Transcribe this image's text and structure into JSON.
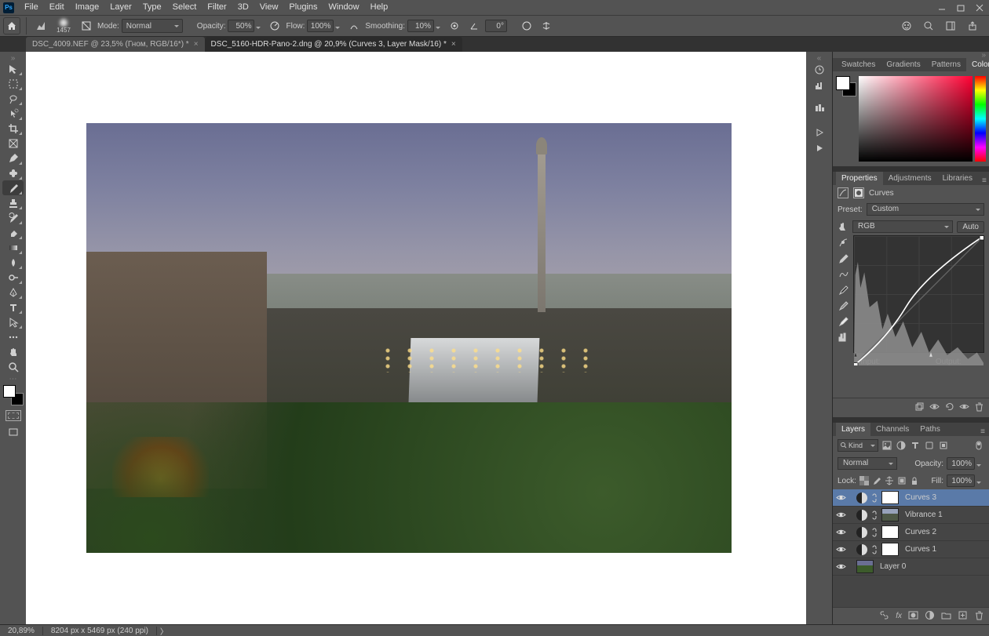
{
  "menu": [
    "File",
    "Edit",
    "Image",
    "Layer",
    "Type",
    "Select",
    "Filter",
    "3D",
    "View",
    "Plugins",
    "Window",
    "Help"
  ],
  "options": {
    "brush_size": "1457",
    "mode_label": "Mode:",
    "mode_value": "Normal",
    "opacity_label": "Opacity:",
    "opacity_value": "50%",
    "flow_label": "Flow:",
    "flow_value": "100%",
    "smoothing_label": "Smoothing:",
    "smoothing_value": "10%",
    "angle_value": "0°"
  },
  "tabs": [
    {
      "title": "DSC_4009.NEF @ 23,5% (Гном, RGB/16*) *",
      "active": false
    },
    {
      "title": "DSC_5160-HDR-Pano-2.dng @ 20,9% (Curves 3, Layer Mask/16) *",
      "active": true
    }
  ],
  "right_panels": {
    "color_tabs": [
      "Swatches",
      "Gradients",
      "Patterns",
      "Color"
    ],
    "color_active": "Color",
    "props_tabs": [
      "Properties",
      "Adjustments",
      "Libraries"
    ],
    "props_active": "Properties",
    "props_title": "Curves",
    "preset_label": "Preset:",
    "preset_value": "Custom",
    "channel_value": "RGB",
    "auto_label": "Auto",
    "input_label": "Input:",
    "output_label": "Output:",
    "layers_tabs": [
      "Layers",
      "Channels",
      "Paths"
    ],
    "layers_active": "Layers",
    "kind_label": "Kind",
    "blend_mode": "Normal",
    "lay_opacity_label": "Opacity:",
    "lay_opacity_value": "100%",
    "lock_label": "Lock:",
    "fill_label": "Fill:",
    "fill_value": "100%",
    "layers": [
      {
        "name": "Curves 3",
        "type": "adj",
        "selected": true
      },
      {
        "name": "Vibrance 1",
        "type": "vib",
        "selected": false
      },
      {
        "name": "Curves 2",
        "type": "adj",
        "selected": false
      },
      {
        "name": "Curves 1",
        "type": "adj",
        "selected": false
      },
      {
        "name": "Layer 0",
        "type": "image",
        "selected": false
      }
    ]
  },
  "status": {
    "zoom": "20,89%",
    "doc": "8204 px x 5469 px (240 ppi)"
  }
}
